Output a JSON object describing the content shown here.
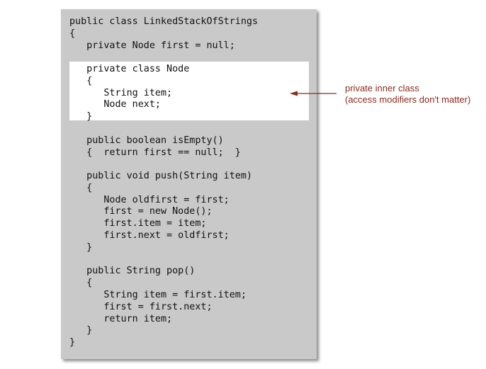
{
  "accent_color": "#8b2a1f",
  "code_lines": [
    "public class LinkedStackOfStrings",
    "{",
    "   private Node first = null;",
    "",
    "   private class Node",
    "   {",
    "      String item;",
    "      Node next;",
    "   }",
    "",
    "   public boolean isEmpty()",
    "   {  return first == null;  }",
    "",
    "   public void push(String item)",
    "   {",
    "      Node oldfirst = first;",
    "      first = new Node();",
    "      first.item = item;",
    "      first.next = oldfirst;",
    "   }",
    "",
    "   public String pop()",
    "   {",
    "      String item = first.item;",
    "      first = first.next;",
    "      return item;",
    "   }",
    "}"
  ],
  "annotation": {
    "line1": "private inner class",
    "line2": "(access modifiers don't matter)"
  }
}
